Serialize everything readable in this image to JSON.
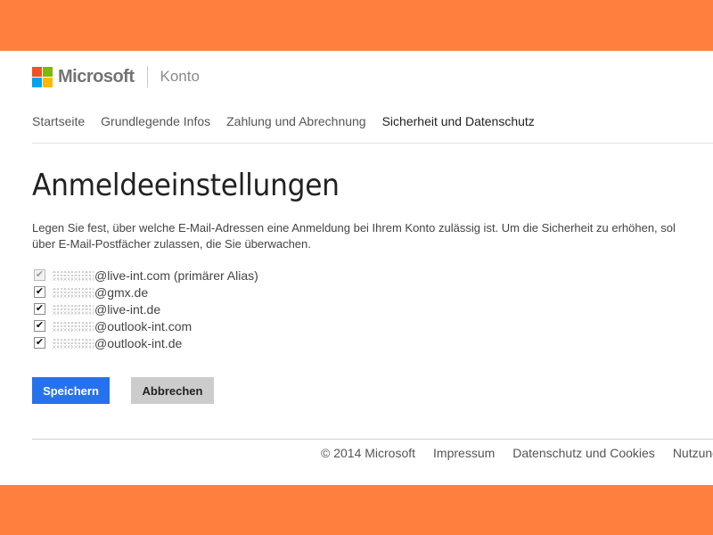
{
  "colors": {
    "frame_orange": "#ff7f3f",
    "accent_blue": "#2672ec",
    "logo_red": "#f25022",
    "logo_green": "#7fba00",
    "logo_blue": "#00a4ef",
    "logo_yellow": "#ffb900"
  },
  "header": {
    "brand": "Microsoft",
    "section": "Konto"
  },
  "nav": {
    "items": [
      {
        "label": "Startseite"
      },
      {
        "label": "Grundlegende Infos"
      },
      {
        "label": "Zahlung und Abrechnung"
      },
      {
        "label": "Sicherheit und Datenschutz",
        "active": true
      }
    ]
  },
  "main": {
    "title": "Anmeldeeinstellungen",
    "description_line1": "Legen Sie fest, über welche E-Mail-Adressen eine Anmeldung bei Ihrem Konto zulässig ist. Um die Sicherheit zu erhöhen, sol",
    "description_line2": "über E-Mail-Postfächer zulassen, die Sie überwachen.",
    "emails": [
      {
        "address": "@live-int.com (primärer Alias)",
        "checked": true,
        "disabled": true
      },
      {
        "address": "@gmx.de",
        "checked": true,
        "disabled": false
      },
      {
        "address": "@live-int.de",
        "checked": true,
        "disabled": false
      },
      {
        "address": "@outlook-int.com",
        "checked": true,
        "disabled": false
      },
      {
        "address": "@outlook-int.de",
        "checked": true,
        "disabled": false
      }
    ],
    "save_label": "Speichern",
    "cancel_label": "Abbrechen"
  },
  "footer": {
    "copyright": "© 2014 Microsoft",
    "impressum": "Impressum",
    "privacy": "Datenschutz und Cookies",
    "terms": "Nutzung"
  }
}
